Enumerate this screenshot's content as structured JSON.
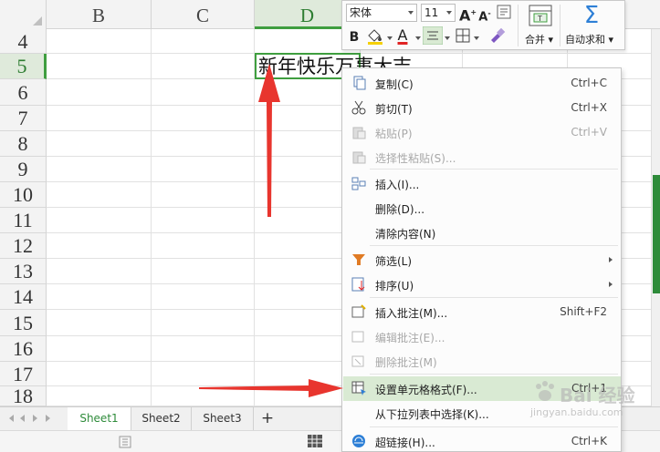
{
  "sheet": {
    "columns": [
      {
        "label": "B",
        "selected": false
      },
      {
        "label": "C",
        "selected": false
      },
      {
        "label": "D",
        "selected": true
      }
    ],
    "rows": [
      {
        "label": "4",
        "selected": false
      },
      {
        "label": "5",
        "selected": true
      },
      {
        "label": "6",
        "selected": false
      },
      {
        "label": "7",
        "selected": false
      },
      {
        "label": "8",
        "selected": false
      },
      {
        "label": "9",
        "selected": false
      },
      {
        "label": "10",
        "selected": false
      },
      {
        "label": "11",
        "selected": false
      },
      {
        "label": "12",
        "selected": false
      },
      {
        "label": "13",
        "selected": false
      },
      {
        "label": "14",
        "selected": false
      },
      {
        "label": "15",
        "selected": false
      },
      {
        "label": "16",
        "selected": false
      },
      {
        "label": "17",
        "selected": false
      },
      {
        "label": "18",
        "selected": false
      }
    ],
    "active_cell_text": "新年快乐万事大吉"
  },
  "mini_toolbar": {
    "font_name": "宋体",
    "font_size": "11",
    "merge_label": "合并",
    "autosum_label": "自动求和"
  },
  "context_menu": {
    "items": [
      {
        "label": "复制(C)",
        "shortcut": "Ctrl+C",
        "icon": "copy-icon",
        "disabled": false
      },
      {
        "label": "剪切(T)",
        "shortcut": "Ctrl+X",
        "icon": "scissors-icon",
        "disabled": false
      },
      {
        "label": "粘贴(P)",
        "shortcut": "Ctrl+V",
        "icon": "paste-icon",
        "disabled": true
      },
      {
        "label": "选择性粘贴(S)...",
        "shortcut": "",
        "icon": "paste-special-icon",
        "disabled": true
      },
      {
        "label": "插入(I)...",
        "shortcut": "",
        "icon": "insert-icon",
        "disabled": false
      },
      {
        "label": "删除(D)...",
        "shortcut": "",
        "icon": "",
        "disabled": false
      },
      {
        "label": "清除内容(N)",
        "shortcut": "",
        "icon": "",
        "disabled": false
      },
      {
        "label": "筛选(L)",
        "shortcut": "",
        "icon": "filter-icon",
        "disabled": false,
        "submenu": true
      },
      {
        "label": "排序(U)",
        "shortcut": "",
        "icon": "sort-icon",
        "disabled": false,
        "submenu": true
      },
      {
        "label": "插入批注(M)...",
        "shortcut": "Shift+F2",
        "icon": "insert-comment-icon",
        "disabled": false
      },
      {
        "label": "编辑批注(E)...",
        "shortcut": "",
        "icon": "edit-comment-icon",
        "disabled": true
      },
      {
        "label": "删除批注(M)",
        "shortcut": "",
        "icon": "delete-comment-icon",
        "disabled": true
      },
      {
        "label": "设置单元格格式(F)...",
        "shortcut": "Ctrl+1",
        "icon": "format-cells-icon",
        "disabled": false,
        "highlighted": true
      },
      {
        "label": "从下拉列表中选择(K)...",
        "shortcut": "",
        "icon": "",
        "disabled": false
      },
      {
        "label": "超链接(H)...",
        "shortcut": "Ctrl+K",
        "icon": "hyperlink-icon",
        "disabled": false
      }
    ]
  },
  "sheet_tabs": [
    "Sheet1",
    "Sheet2",
    "Sheet3"
  ],
  "active_tab": "Sheet1",
  "add_sheet_label": "+",
  "watermark": {
    "main": "Bai 经验",
    "sub": "jingyan.baidu.com"
  },
  "colors": {
    "accent_green": "#3f9e3f",
    "highlight": "#d9ead3",
    "arrow_red": "#e8352e"
  }
}
